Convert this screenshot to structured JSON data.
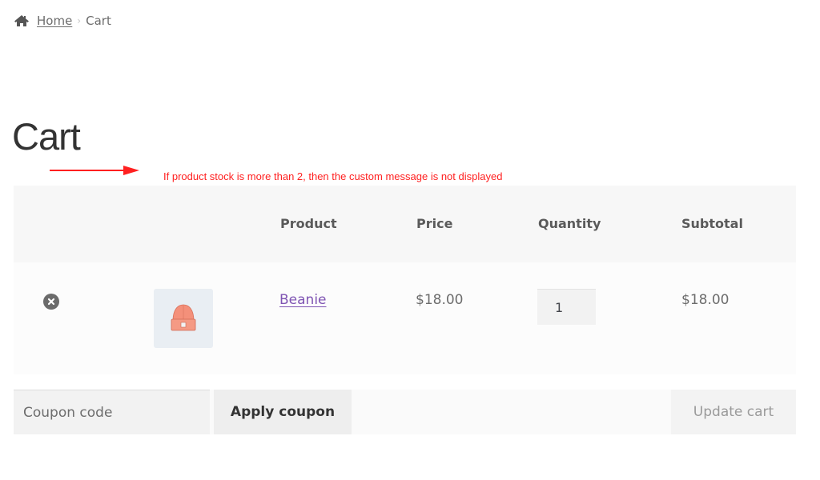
{
  "breadcrumb": {
    "home_icon": "home-icon",
    "home_label": "Home",
    "separator_icon": "chevron-right-icon",
    "current": "Cart"
  },
  "page": {
    "title": "Cart"
  },
  "annotation": {
    "arrow_icon": "arrow-right-icon",
    "text": "If product stock is more than 2, then the custom message is not displayed",
    "color": "#ff2020"
  },
  "cart_table": {
    "headers": [
      "",
      "",
      "Product",
      "Price",
      "Quantity",
      "Subtotal"
    ],
    "rows": [
      {
        "remove_icon": "remove-circle-x-icon",
        "thumbnail": "beanie-image",
        "product": "Beanie",
        "price": "$18.00",
        "quantity": "1",
        "subtotal": "$18.00"
      }
    ]
  },
  "actions": {
    "coupon_placeholder": "Coupon code",
    "coupon_value": "",
    "apply_coupon_label": "Apply coupon",
    "update_cart_label": "Update cart"
  },
  "colors": {
    "link": "#7f54b3",
    "header_bg": "#f7f7f7",
    "annotation": "#ff2020"
  }
}
